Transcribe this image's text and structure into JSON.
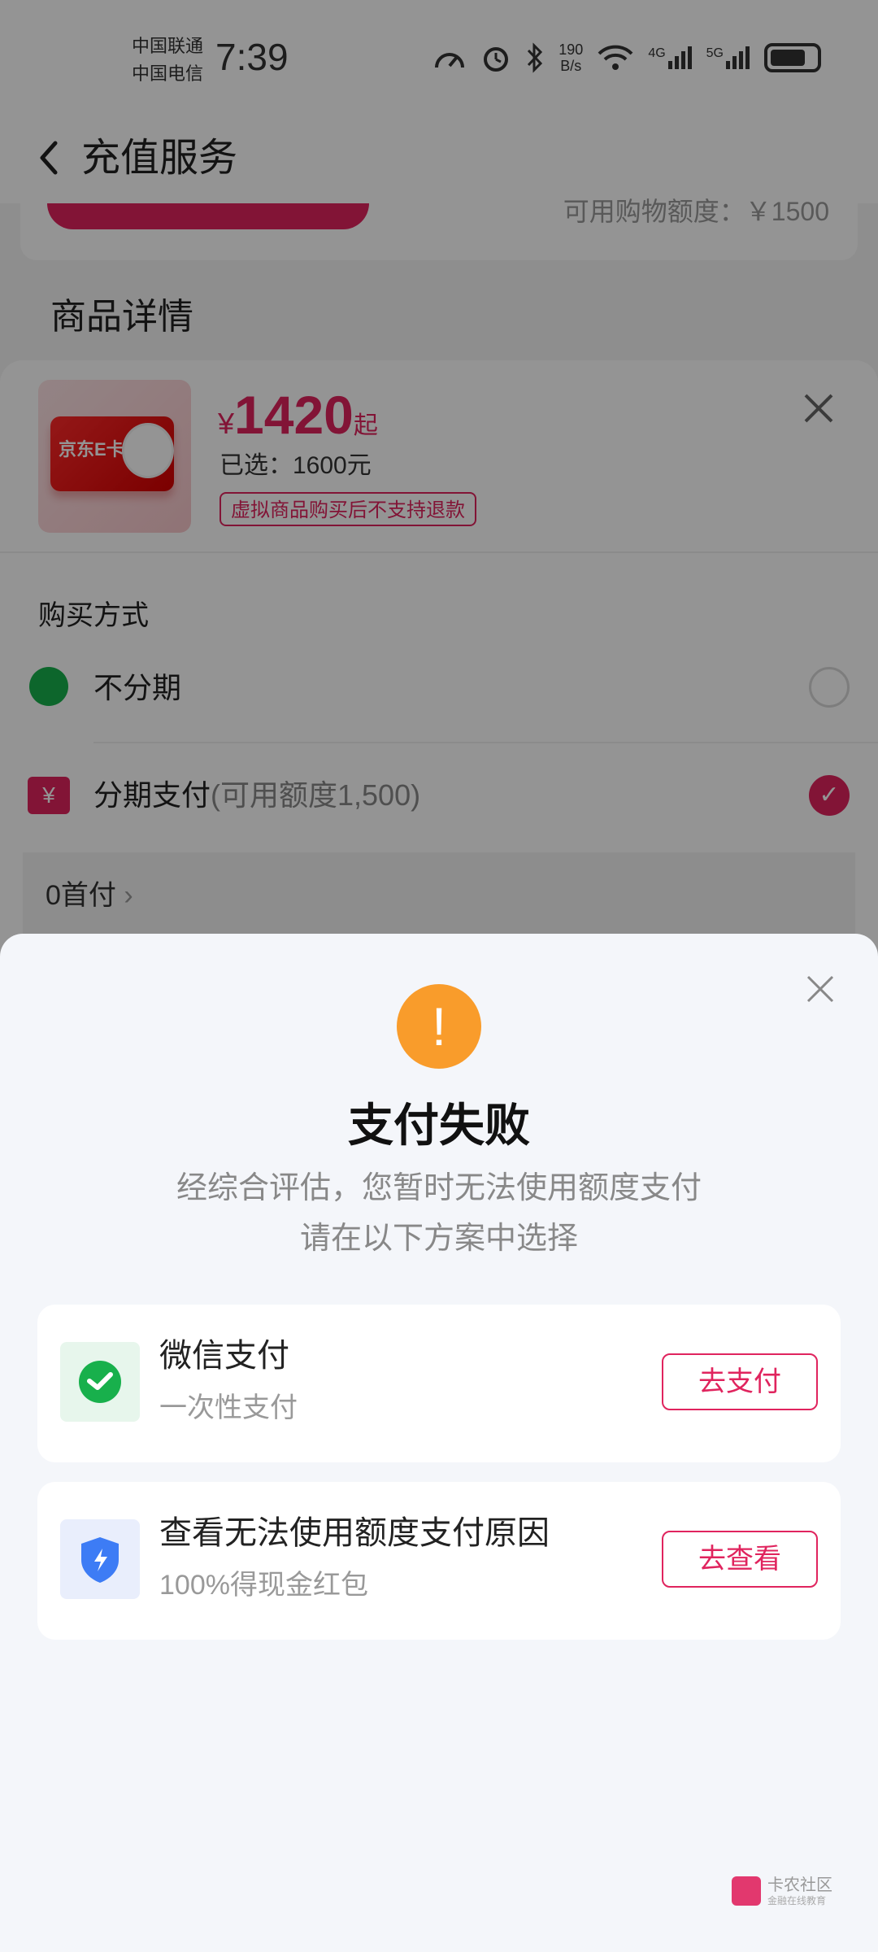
{
  "status": {
    "carrier1": "中国联通",
    "carrier2": "中国电信",
    "time": "7:39",
    "net_speed_value": "190",
    "net_speed_unit": "B/s",
    "sig1": "4G",
    "sig2": "5G"
  },
  "header": {
    "title": "充值服务"
  },
  "background": {
    "limit_text": "可用购物额度：￥1500",
    "section_title": "商品详情"
  },
  "product_sheet": {
    "ecard_label": "京东E卡",
    "price_currency": "¥",
    "price_value": "1420",
    "price_suffix": "起",
    "selected_text": "已选：1600元",
    "refund_notice": "虚拟商品购买后不支持退款",
    "buy_method_title": "购买方式",
    "option1_label": "不分期",
    "option2_label": "分期支付",
    "option2_sub": "(可用额度1,500)",
    "plan_label": "0首付"
  },
  "fail_sheet": {
    "title": "支付失败",
    "desc_line1": "经综合评估，您暂时无法使用额度支付",
    "desc_line2": "请在以下方案中选择",
    "card1": {
      "title": "微信支付",
      "sub": "一次性支付",
      "button": "去支付",
      "icon": "wechat-pay-icon"
    },
    "card2": {
      "title": "查看无法使用额度支付原因",
      "sub": "100%得现金红包",
      "button": "去查看",
      "icon": "shield-bolt-icon"
    }
  },
  "watermark": {
    "name": "卡农社区",
    "sub": "金融在线教育"
  },
  "colors": {
    "accent": "#e0245e",
    "warning": "#f99c2b",
    "wechat": "#18b04c"
  }
}
